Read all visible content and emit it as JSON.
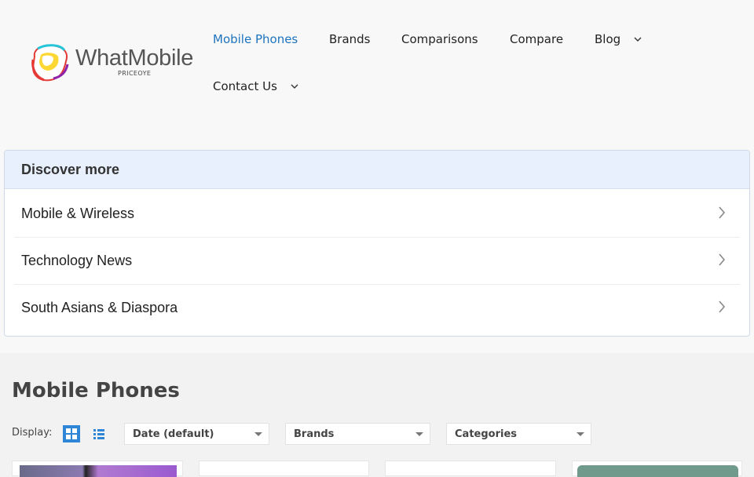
{
  "site": {
    "logo_text": "WhatMobile",
    "logo_subtext": "PRICEOYE"
  },
  "nav": {
    "items": [
      {
        "label": "Mobile Phones",
        "active": true
      },
      {
        "label": "Brands"
      },
      {
        "label": "Comparisons"
      },
      {
        "label": "Compare"
      },
      {
        "label": "Blog",
        "has_dropdown": true
      },
      {
        "label": "Contact Us",
        "has_dropdown": true
      }
    ]
  },
  "discover": {
    "title": "Discover more",
    "items": [
      {
        "label": "Mobile & Wireless"
      },
      {
        "label": "Technology News"
      },
      {
        "label": "South Asians & Diaspora"
      }
    ]
  },
  "listing": {
    "title": "Mobile Phones",
    "display_label": "Display:",
    "filters": [
      {
        "label": "Date (default)"
      },
      {
        "label": "Brands"
      },
      {
        "label": "Categories"
      }
    ]
  },
  "colors": {
    "accent": "#1e73be",
    "grid_button": "#2f86d6",
    "discover_header": "#e8f0fe"
  }
}
